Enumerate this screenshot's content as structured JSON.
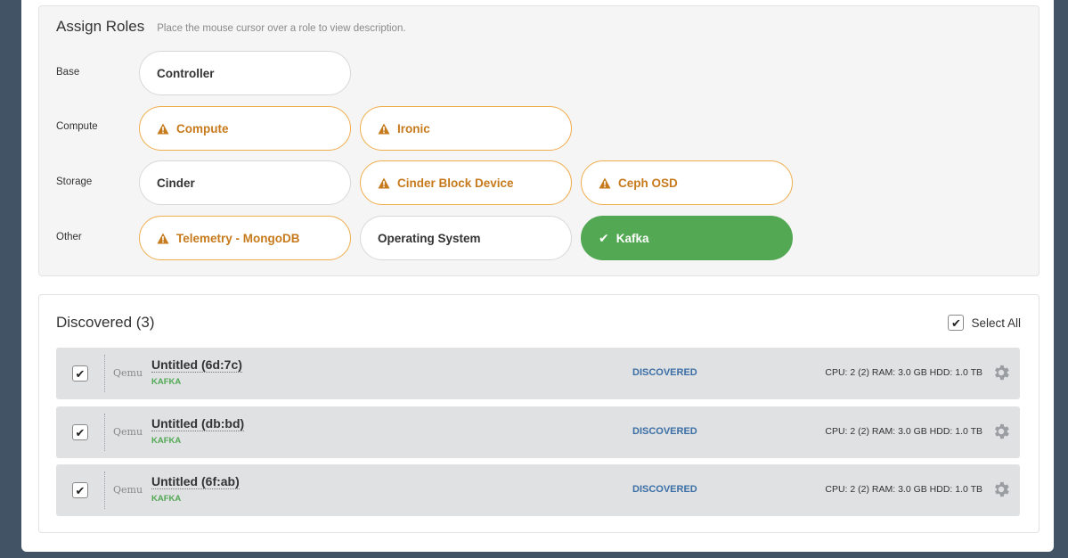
{
  "assign_roles": {
    "title": "Assign Roles",
    "hint": "Place the mouse cursor over a role to view description.",
    "groups": {
      "base": "Base",
      "compute": "Compute",
      "storage": "Storage",
      "other": "Other"
    },
    "roles": {
      "controller": "Controller",
      "compute": "Compute",
      "ironic": "Ironic",
      "cinder": "Cinder",
      "cinder_block_device": "Cinder Block Device",
      "ceph_osd": "Ceph OSD",
      "telemetry_mongodb": "Telemetry - MongoDB",
      "operating_system": "Operating System",
      "kafka": "Kafka"
    }
  },
  "discovered": {
    "title": "Discovered (3)",
    "select_all_label": "Select All",
    "nodes": [
      {
        "vendor": "Qemu",
        "name": "Untitled (6d:7c)",
        "role": "KAFKA",
        "status": "DISCOVERED",
        "specs": "CPU: 2 (2)  RAM: 3.0 GB  HDD: 1.0 TB"
      },
      {
        "vendor": "Qemu",
        "name": "Untitled (db:bd)",
        "role": "KAFKA",
        "status": "DISCOVERED",
        "specs": "CPU: 2 (2)  RAM: 3.0 GB  HDD: 1.0 TB"
      },
      {
        "vendor": "Qemu",
        "name": "Untitled (6f:ab)",
        "role": "KAFKA",
        "status": "DISCOVERED",
        "specs": "CPU: 2 (2)  RAM: 3.0 GB  HDD: 1.0 TB"
      }
    ]
  },
  "colors": {
    "background": "#415364",
    "warning": "#f0ad4e",
    "active": "#52a853",
    "status": "#3b6ea5"
  },
  "icons": {
    "warning": "warning-triangle-icon",
    "check": "checkmark-icon",
    "gear": "gear-icon"
  }
}
